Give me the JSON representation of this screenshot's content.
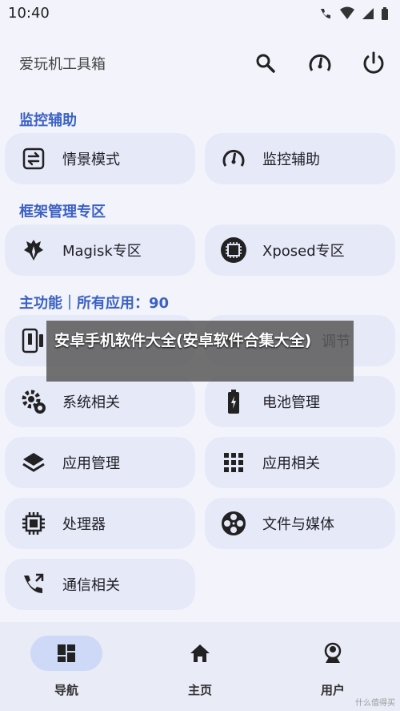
{
  "status": {
    "time": "10:40"
  },
  "appbar": {
    "title": "爱玩机工具箱"
  },
  "sections": {
    "assist": "监控辅助",
    "framework": "框架管理专区",
    "main": "主功能｜所有应用：90"
  },
  "cards": {
    "scene_mode": "情景模式",
    "monitor_assist": "监控辅助",
    "magisk": "Magisk专区",
    "xposed": "Xposed专区",
    "system": "系统相关",
    "battery": "电池管理",
    "app_manage": "应用管理",
    "app_related": "应用相关",
    "processor": "处理器",
    "file_media": "文件与媒体",
    "telecom": "通信相关",
    "partial_right": "调节"
  },
  "overlay": {
    "text": "安卓手机软件大全(安卓软件合集大全)"
  },
  "nav": {
    "navigate": "导航",
    "home": "主页",
    "user": "用户"
  },
  "watermark": "什么值得买",
  "colors": {
    "accent": "#3b61c4",
    "card": "#e6e9f8",
    "nav_active": "#cdd9f7"
  }
}
